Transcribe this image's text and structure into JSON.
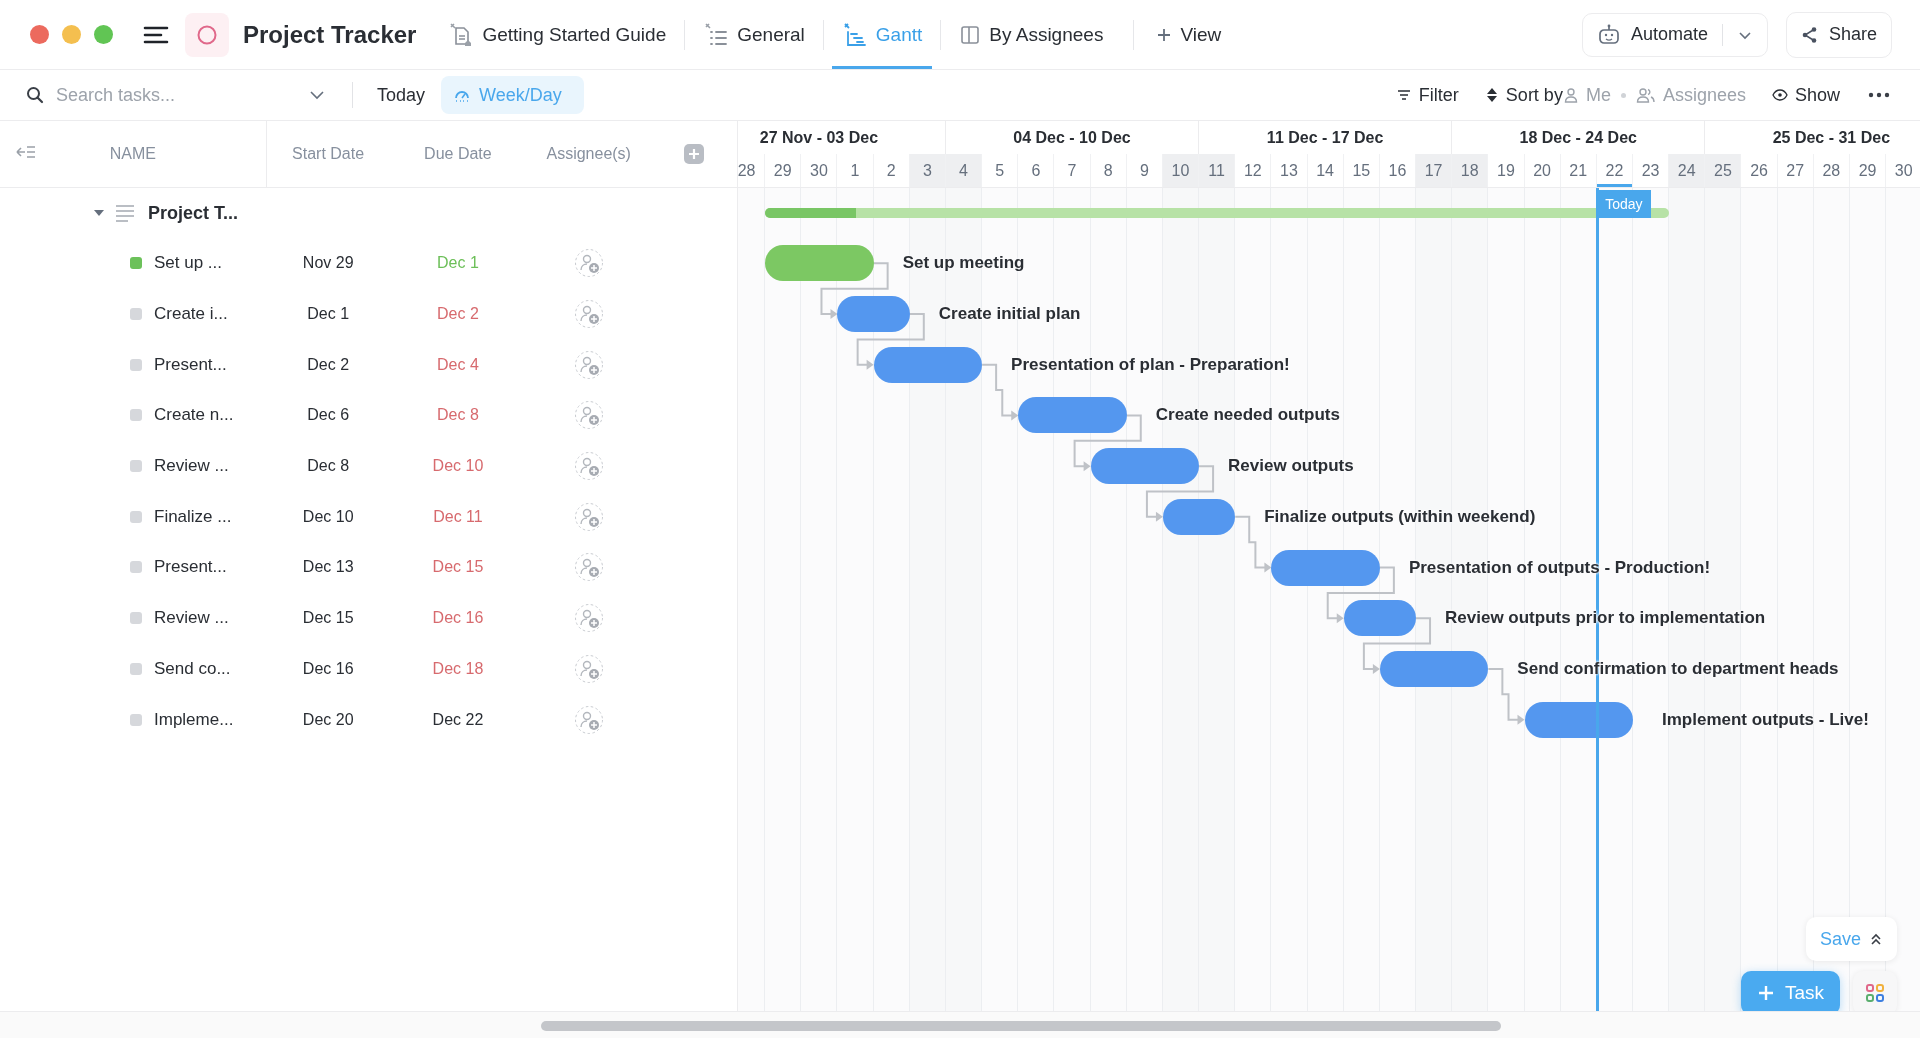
{
  "header": {
    "title": "Project Tracker",
    "views": [
      {
        "label": "Getting Started Guide",
        "kind": "doc",
        "selected": false
      },
      {
        "label": "General",
        "kind": "list",
        "selected": false
      },
      {
        "label": "Gantt",
        "kind": "gantt",
        "selected": true
      },
      {
        "label": "By Assignees",
        "kind": "board",
        "selected": false
      }
    ],
    "add_view": "View",
    "automate": "Automate",
    "share": "Share"
  },
  "toolbar": {
    "search": {
      "placeholder": "Search tasks..."
    },
    "today": "Today",
    "scale": "Week/Day",
    "actions": [
      {
        "label": "Filter",
        "kind": "filter",
        "muted": false
      },
      {
        "label": "Sort by",
        "kind": "sort",
        "muted": false
      },
      {
        "label": "Me",
        "kind": "me",
        "muted": true
      },
      {
        "label": "Assignees",
        "kind": "assignees",
        "muted": true
      },
      {
        "label": "Show",
        "kind": "show",
        "muted": false
      }
    ]
  },
  "table": {
    "columns": [
      "NAME",
      "Start Date",
      "Due Date",
      "Assignee(s)"
    ],
    "group": {
      "name": "Project T...",
      "expanded": true
    },
    "rows": [
      {
        "name": "Set up ...",
        "start": "Nov 29",
        "due": "Dec 1",
        "done": true,
        "overdue": false
      },
      {
        "name": "Create i...",
        "start": "Dec 1",
        "due": "Dec 2",
        "done": false,
        "overdue": true
      },
      {
        "name": "Present...",
        "start": "Dec 2",
        "due": "Dec 4",
        "done": false,
        "overdue": true
      },
      {
        "name": "Create n...",
        "start": "Dec 6",
        "due": "Dec 8",
        "done": false,
        "overdue": true
      },
      {
        "name": "Review ...",
        "start": "Dec 8",
        "due": "Dec 10",
        "done": false,
        "overdue": true
      },
      {
        "name": "Finalize ...",
        "start": "Dec 10",
        "due": "Dec 11",
        "done": false,
        "overdue": true
      },
      {
        "name": "Present...",
        "start": "Dec 13",
        "due": "Dec 15",
        "done": false,
        "overdue": true
      },
      {
        "name": "Review ...",
        "start": "Dec 15",
        "due": "Dec 16",
        "done": false,
        "overdue": true
      },
      {
        "name": "Send co...",
        "start": "Dec 16",
        "due": "Dec 18",
        "done": false,
        "overdue": true
      },
      {
        "name": "Impleme...",
        "start": "Dec 20",
        "due": "Dec 22",
        "done": false,
        "overdue": false
      }
    ]
  },
  "gantt": {
    "weeks": [
      {
        "label": "27 Nov - 03 Dec",
        "days": [
          {
            "label": "28",
            "weekend": false,
            "today": false
          },
          {
            "label": "29",
            "weekend": false,
            "today": false
          },
          {
            "label": "30",
            "weekend": false,
            "today": false
          },
          {
            "label": "1",
            "weekend": false,
            "today": false
          },
          {
            "label": "2",
            "weekend": false,
            "today": false
          },
          {
            "label": "3",
            "weekend": true,
            "today": false
          }
        ]
      },
      {
        "label": "04 Dec - 10 Dec",
        "days": [
          {
            "label": "4",
            "weekend": true,
            "today": false
          },
          {
            "label": "5",
            "weekend": false,
            "today": false
          },
          {
            "label": "6",
            "weekend": false,
            "today": false
          },
          {
            "label": "7",
            "weekend": false,
            "today": false
          },
          {
            "label": "8",
            "weekend": false,
            "today": false
          },
          {
            "label": "9",
            "weekend": false,
            "today": false
          },
          {
            "label": "10",
            "weekend": true,
            "today": false
          }
        ]
      },
      {
        "label": "11 Dec - 17 Dec",
        "days": [
          {
            "label": "11",
            "weekend": true,
            "today": false
          },
          {
            "label": "12",
            "weekend": false,
            "today": false
          },
          {
            "label": "13",
            "weekend": false,
            "today": false
          },
          {
            "label": "14",
            "weekend": false,
            "today": false
          },
          {
            "label": "15",
            "weekend": false,
            "today": false
          },
          {
            "label": "16",
            "weekend": false,
            "today": false
          },
          {
            "label": "17",
            "weekend": true,
            "today": false
          }
        ]
      },
      {
        "label": "18 Dec - 24 Dec",
        "days": [
          {
            "label": "18",
            "weekend": true,
            "today": false
          },
          {
            "label": "19",
            "weekend": false,
            "today": false
          },
          {
            "label": "20",
            "weekend": false,
            "today": false
          },
          {
            "label": "21",
            "weekend": false,
            "today": false
          },
          {
            "label": "22",
            "weekend": false,
            "today": true
          },
          {
            "label": "23",
            "weekend": false,
            "today": false
          },
          {
            "label": "24",
            "weekend": true,
            "today": false
          }
        ]
      },
      {
        "label": "25 Dec - 31 Dec",
        "days": [
          {
            "label": "25",
            "weekend": true,
            "today": false
          },
          {
            "label": "26",
            "weekend": false,
            "today": false
          },
          {
            "label": "27",
            "weekend": false,
            "today": false
          },
          {
            "label": "28",
            "weekend": false,
            "today": false
          },
          {
            "label": "29",
            "weekend": false,
            "today": false
          },
          {
            "label": "30",
            "weekend": false,
            "today": false
          }
        ]
      }
    ],
    "today_label": "Today",
    "project_bar": {
      "level": 0.1
    },
    "bars": [
      {
        "label": "Set up meeting",
        "done": true
      },
      {
        "label": "Create initial plan",
        "done": false
      },
      {
        "label": "Presentation of plan - Preparation!",
        "done": false
      },
      {
        "label": "Create needed outputs",
        "done": false
      },
      {
        "label": "Review outputs",
        "done": false
      },
      {
        "label": "Finalize outputs (within weekend)",
        "done": false
      },
      {
        "label": "Presentation of outputs - Production!",
        "done": false
      },
      {
        "label": "Review outputs prior to implementation",
        "done": false
      },
      {
        "label": "Send confirmation to department heads",
        "done": false
      },
      {
        "label": "Implement outputs - Live!",
        "done": false
      }
    ]
  },
  "footer": {
    "save": "Save",
    "add_task": "Task"
  }
}
